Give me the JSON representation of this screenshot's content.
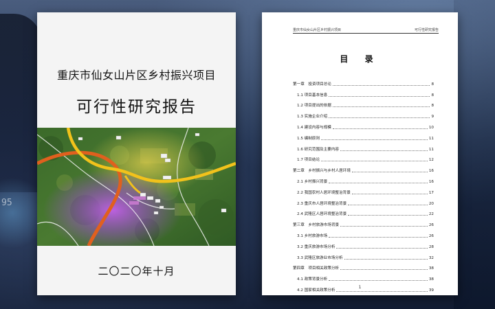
{
  "cover": {
    "title": "重庆市仙女山片区乡村振兴项目",
    "subtitle": "可行性研究报告",
    "date": "二〇二〇年十月"
  },
  "background": {
    "number_text": "95"
  },
  "toc": {
    "header_left": "重庆市仙女山片区乡村振兴项目",
    "header_right": "可行性研究报告",
    "heading": "目 录",
    "page_number": "1",
    "entries": [
      {
        "text": "第一章　投资项目总论",
        "page": "8",
        "level": 1
      },
      {
        "text": "1.1 项目基本信息",
        "page": "8",
        "level": 2
      },
      {
        "text": "1.2 项目提出的依据",
        "page": "8",
        "level": 2
      },
      {
        "text": "1.3 实施企业介绍",
        "page": "9",
        "level": 2
      },
      {
        "text": "1.4 建设内容与规模",
        "page": "10",
        "level": 2
      },
      {
        "text": "1.5 编制原则",
        "page": "11",
        "level": 2
      },
      {
        "text": "1.6 研究范围及主要内容",
        "page": "11",
        "level": 2
      },
      {
        "text": "1.7 项目结论",
        "page": "12",
        "level": 2
      },
      {
        "text": "第二章　乡村振兴与乡村人居环境",
        "page": "16",
        "level": 1
      },
      {
        "text": "2.1 乡村振兴背景",
        "page": "16",
        "level": 2
      },
      {
        "text": "2.2 我国农村人居环境整治背景",
        "page": "17",
        "level": 2
      },
      {
        "text": "2.3 重庆市人居环境整治背景",
        "page": "20",
        "level": 2
      },
      {
        "text": "2.4 武隆区人居环境整治背景",
        "page": "22",
        "level": 2
      },
      {
        "text": "第三章　乡村旅游市场背景",
        "page": "26",
        "level": 1
      },
      {
        "text": "3.1 乡村旅游市场",
        "page": "26",
        "level": 2
      },
      {
        "text": "3.2 重庆旅游市场分析",
        "page": "28",
        "level": 2
      },
      {
        "text": "3.3 武隆区旅游业市场分析",
        "page": "32",
        "level": 2
      },
      {
        "text": "第四章　项目相关政策分析",
        "page": "38",
        "level": 1
      },
      {
        "text": "4.1 政策背景分析",
        "page": "38",
        "level": 2
      },
      {
        "text": "4.2 国家相关政策分析",
        "page": "39",
        "level": 2
      }
    ]
  },
  "colors": {
    "road_orange": "#e0601e",
    "road_yellow": "#f2c21b",
    "vegetation": "#3f6a2c"
  }
}
